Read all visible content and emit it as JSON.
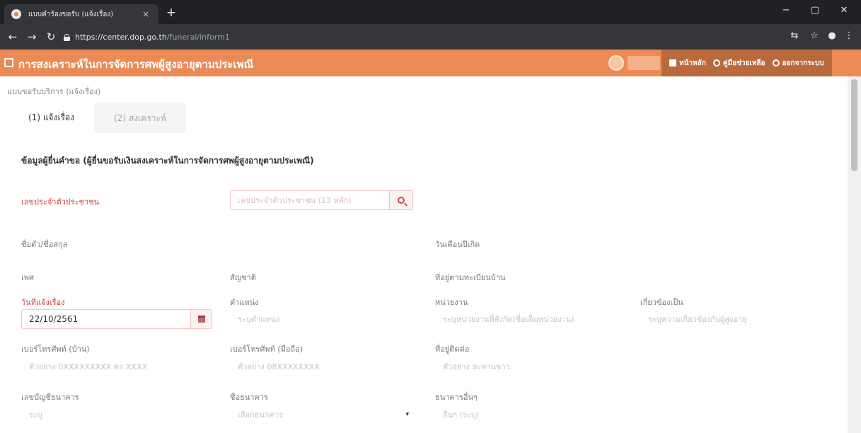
{
  "browser": {
    "tab_title": "แบบคำร้องขอรับ (แจ้งเรื่อง)",
    "tab_close": "×",
    "new_tab": "+",
    "url_host": "https://center.dop.go.th",
    "url_path": "/funeral/inform1",
    "controls": {
      "minimize": "−",
      "maximize": "▢",
      "close": "✕"
    },
    "nav": {
      "back": "←",
      "forward": "→",
      "reload": "↻"
    }
  },
  "header": {
    "title": "การสงเคราะห์ในการจัดการศพผู้สูงอายุตามประเพณี",
    "nav": [
      {
        "label": "หน้าหลัก",
        "icon": "home-icon"
      },
      {
        "label": "คู่มือช่วยเหลือ",
        "icon": "help-icon"
      },
      {
        "label": "ออกจากระบบ",
        "icon": "logout-icon"
      }
    ]
  },
  "page": {
    "breadcrumb": "แบบขอรับบริการ (แจ้งเรื่อง)",
    "tabs": [
      {
        "label": "(1) แจ้งเรื่อง",
        "active": true
      },
      {
        "label": "(2) สงเคราะห์",
        "active": false
      }
    ],
    "section_heading": "ข้อมูลผู้ยื่นคำขอ (ผู้ยื่นขอรับเงินสงเคราะห์ในการจัดการศพผู้สูงอายุตามประเพณี)"
  },
  "form": {
    "id_number": {
      "label": "เลขประจำตัวประชาชน",
      "placeholder": "เลขประจำตัวประชาชน (13 หลัก)"
    },
    "full_name": {
      "label": "ชื่อตัว/ชื่อสกุล"
    },
    "birth_date": {
      "label": "วันเดือนปีเกิด"
    },
    "gender": {
      "label": "เพศ"
    },
    "nationality": {
      "label": "สัญชาติ"
    },
    "house_address": {
      "label": "ที่อยู่ตามทะเบียนบ้าน"
    },
    "report_date": {
      "label": "วันที่แจ้งเรื่อง",
      "value": "22/10/2561"
    },
    "position": {
      "label": "ตำแหน่ง",
      "placeholder": "ระบุตำแหน่ง"
    },
    "agency": {
      "label": "หน่วยงาน",
      "placeholder": "ระบุหน่วยงานที่สังกัด(ชื่อเต็มหน่วยงาน)"
    },
    "relationship": {
      "label": "เกี่ยวข้องเป็น",
      "placeholder": "ระบุความเกี่ยวข้องกับผู้สูงอายุ"
    },
    "home_phone": {
      "label": "เบอร์โทรศัพท์ (บ้าน)",
      "placeholder": "ตัวอย่าง 0XXXXXXXXX ต่อ XXXX"
    },
    "mobile_phone": {
      "label": "เบอร์โทรศัพท์ (มือถือ)",
      "placeholder": "ตัวอย่าง 08XXXXXXXX"
    },
    "contact_address": {
      "label": "ที่อยู่ติดต่อ",
      "placeholder": "ตัวอย่าง สะพานขาว"
    },
    "bank_account": {
      "label": "เลขบัญชีธนาคาร",
      "placeholder": "ระบุ"
    },
    "bank_name": {
      "label": "ชื่อธนาคาร",
      "placeholder": "เลือกธนาคาร",
      "caret": "▾"
    },
    "bank_other": {
      "label": "ธนาคารอื่นๆ",
      "placeholder": "อื่นๆ (ระบุ)"
    }
  },
  "colors": {
    "header_bg": "#ec8a55",
    "header_nav_bg": "#b86a3c",
    "required_label": "#d63c3c"
  }
}
